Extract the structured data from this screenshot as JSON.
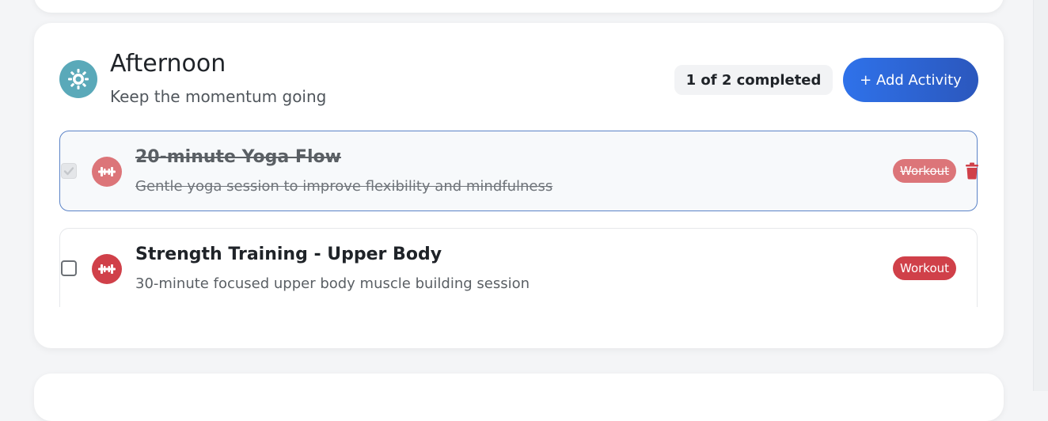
{
  "section": {
    "icon": "sun-icon",
    "title": "Afternoon",
    "subtitle": "Keep the momentum going",
    "progress": "1 of 2 completed",
    "add_button_label": "+ Add Activity"
  },
  "activities": [
    {
      "title": "20-minute Yoga Flow",
      "description": "Gentle yoga session to improve flexibility and mindfulness",
      "tag": "Workout",
      "completed": true,
      "icon": "dumbbell-icon",
      "has_delete": true
    },
    {
      "title": "Strength Training - Upper Body",
      "description": "30-minute focused upper body muscle building session",
      "tag": "Workout",
      "completed": false,
      "icon": "dumbbell-icon",
      "has_delete": false
    }
  ],
  "colors": {
    "accent": "#2f72ea",
    "workout": "#d04049",
    "sun_icon_bg": "#5aa9b9"
  }
}
